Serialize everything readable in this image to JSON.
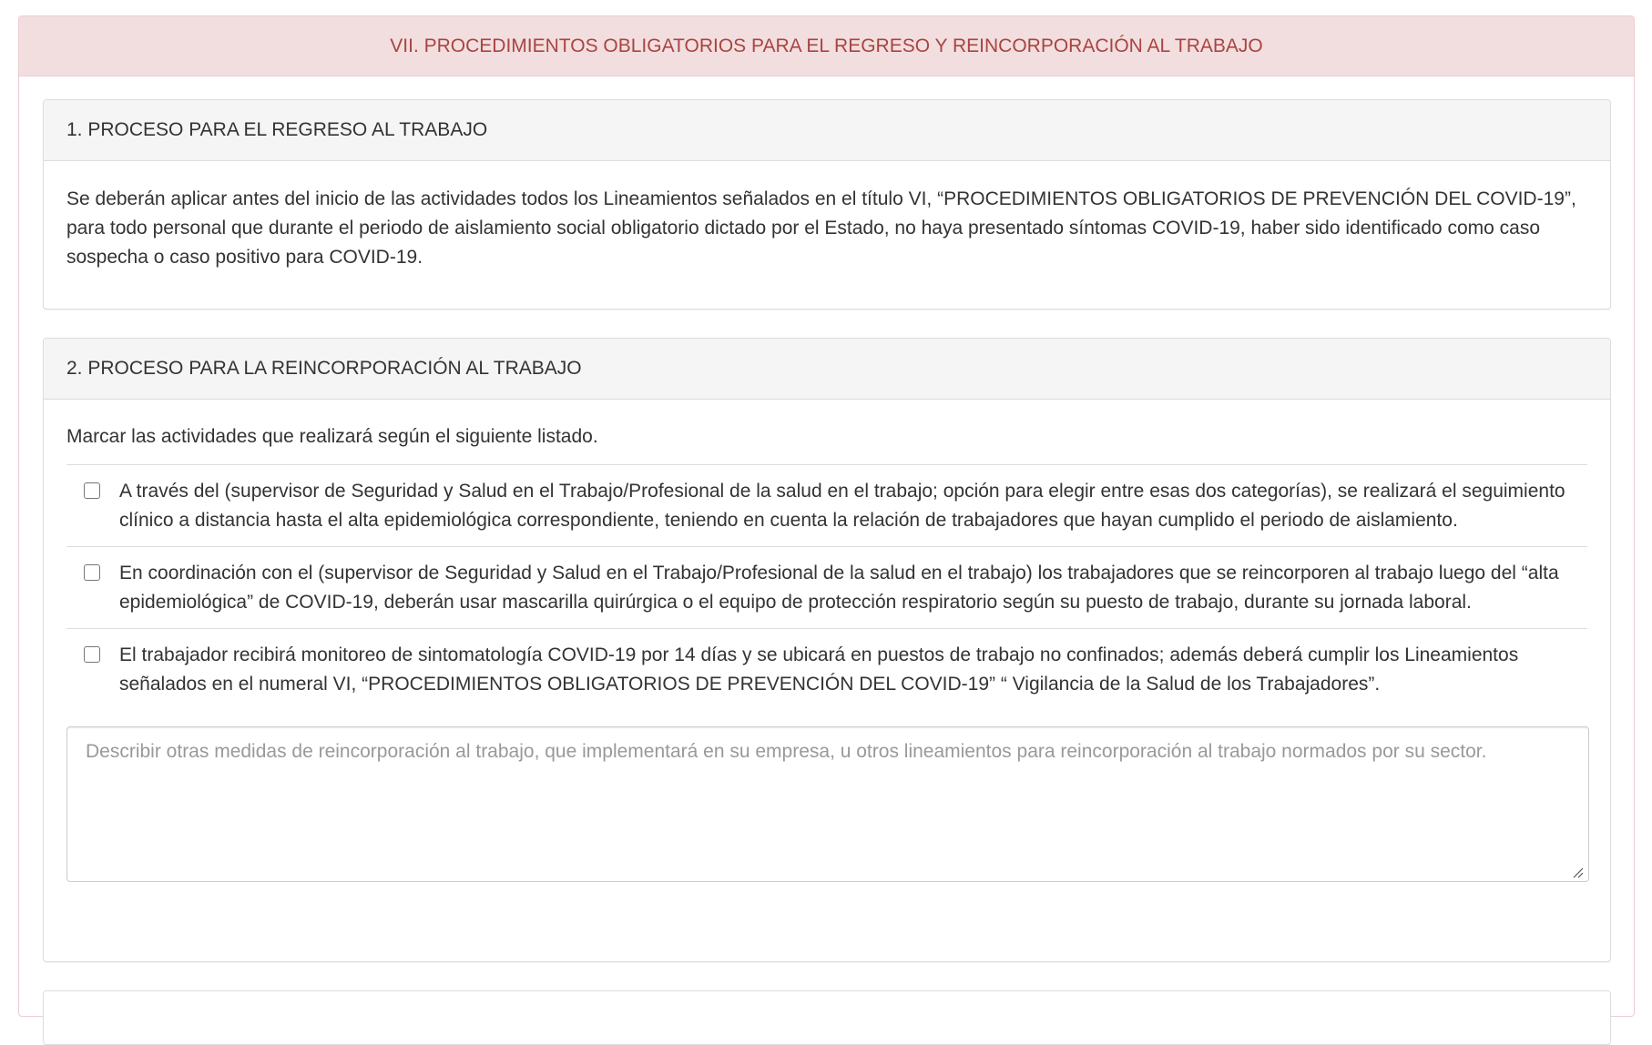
{
  "section": {
    "title": "VII. PROCEDIMIENTOS OBLIGATORIOS PARA EL REGRESO Y REINCORPORACIÓN AL TRABAJO"
  },
  "regreso": {
    "title": "1. PROCESO PARA EL REGRESO AL TRABAJO",
    "body": "Se deberán aplicar antes del inicio de las actividades todos los Lineamientos señalados en el título VI, “PROCEDIMIENTOS OBLIGATORIOS DE PREVENCIÓN DEL COVID-19”, para todo personal que durante el periodo de aislamiento social obligatorio dictado por el Estado, no haya presentado síntomas COVID-19, haber sido identificado como caso sospecha o caso positivo para COVID-19."
  },
  "reincorporacion": {
    "title": "2. PROCESO PARA LA REINCORPORACIÓN AL TRABAJO",
    "intro": "Marcar las actividades que realizará según el siguiente listado.",
    "items": [
      {
        "checked": false,
        "label": "A través del (supervisor de Seguridad y Salud en el Trabajo/Profesional de la salud en el trabajo; opción para elegir entre esas dos categorías), se realizará el seguimiento clínico a distancia hasta el alta epidemiológica correspondiente, teniendo en cuenta la relación de trabajadores que hayan cumplido el periodo de aislamiento."
      },
      {
        "checked": false,
        "label": "En coordinación con el (supervisor de Seguridad y Salud en el Trabajo/Profesional de la salud en el trabajo) los trabajadores que se reincorporen al trabajo luego del “alta epidemiológica” de COVID-19, deberán usar mascarilla quirúrgica o el equipo de protección respiratorio según su puesto de trabajo, durante su jornada laboral."
      },
      {
        "checked": false,
        "label": "El trabajador recibirá monitoreo de sintomatología COVID-19 por 14 días y se ubicará en puestos de trabajo no confinados; además deberá cumplir los Lineamientos señalados en el numeral VI, “PROCEDIMIENTOS OBLIGATORIOS DE PREVENCIÓN DEL COVID-19” “ Vigilancia de la Salud de los Trabajadores”."
      }
    ],
    "other_measures": {
      "value": "",
      "placeholder": "Describir otras medidas de reincorporación al trabajo, que implementará en su empresa, u otros lineamientos para reincorporación al trabajo normados por su sector."
    }
  },
  "colors": {
    "danger_heading_bg": "#f2dede",
    "danger_heading_text": "#a94442",
    "danger_border": "#ebccd1",
    "default_heading_bg": "#f5f5f5",
    "border": "#dddddd",
    "placeholder": "#999999"
  }
}
